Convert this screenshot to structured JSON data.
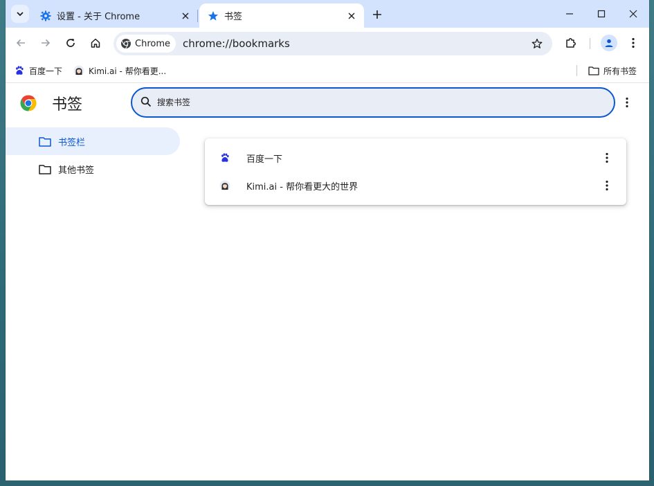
{
  "tabs": [
    {
      "title": "设置 - 关于 Chrome",
      "icon": "gear-icon",
      "active": false
    },
    {
      "title": "书签",
      "icon": "star-icon",
      "active": true
    }
  ],
  "toolbar": {
    "chip_label": "Chrome",
    "url": "chrome://bookmarks"
  },
  "bookmarks_bar": {
    "items": [
      {
        "label": "百度一下",
        "icon": "baidu-paw-icon"
      },
      {
        "label": "Kimi.ai - 帮你看更...",
        "icon": "kimi-avatar-icon"
      }
    ],
    "all_bookmarks": "所有书签"
  },
  "page": {
    "title": "书签",
    "search_placeholder": "搜索书签",
    "sidebar": [
      {
        "label": "书签栏",
        "selected": true
      },
      {
        "label": "其他书签",
        "selected": false
      }
    ],
    "list": [
      {
        "label": "百度一下",
        "icon": "baidu-paw-icon"
      },
      {
        "label": "Kimi.ai - 帮你看更大的世界",
        "icon": "kimi-avatar-icon"
      }
    ]
  },
  "colors": {
    "accent": "#0b57d0",
    "tabstrip": "#d3e3fd",
    "omnibox": "#e9eef6",
    "selected_bg": "#e8f0fe"
  }
}
